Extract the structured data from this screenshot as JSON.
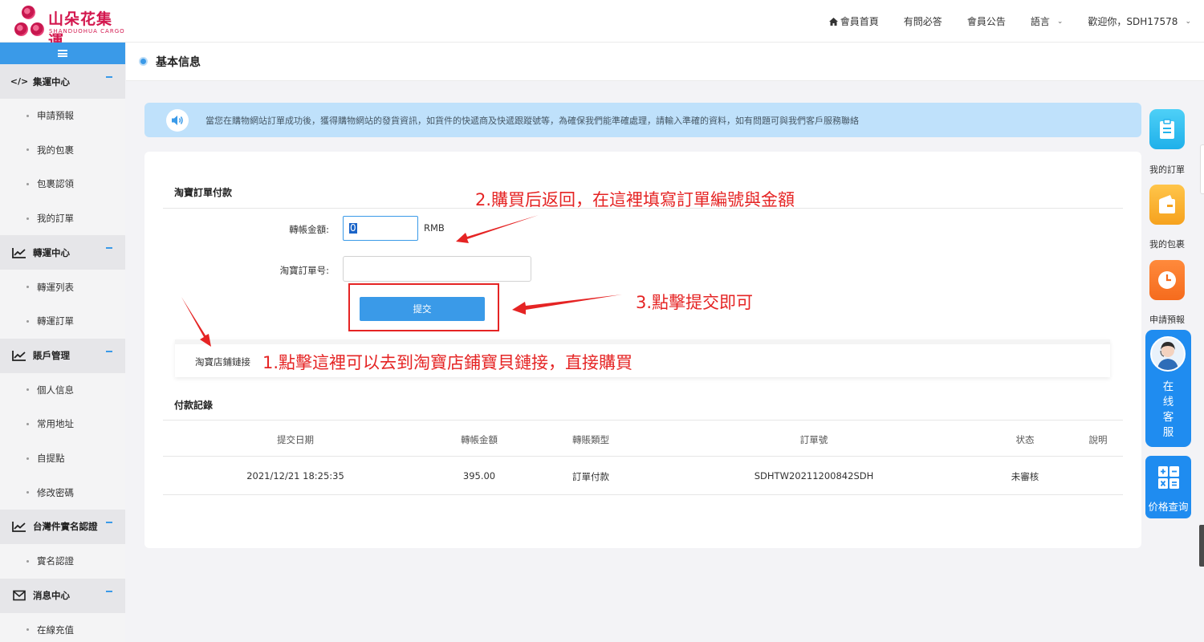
{
  "logo": {
    "name": "山朵花集運",
    "sub": "SHANDUOHUA CARGO"
  },
  "topnav": {
    "home": "會員首頁",
    "faq": "有問必答",
    "announcement": "會員公告",
    "language": "語言",
    "welcome": "歡迎你，SDH17578"
  },
  "sidebar": {
    "sections": [
      {
        "title": "集運中心",
        "items": [
          "申請預報",
          "我的包裹",
          "包裹認領",
          "我的訂單"
        ]
      },
      {
        "title": "轉運中心",
        "items": [
          "轉運列表",
          "轉運訂單"
        ]
      },
      {
        "title": "賬戶管理",
        "items": [
          "個人信息",
          "常用地址",
          "自提點",
          "修改密碼"
        ]
      },
      {
        "title": "台灣件實名認證",
        "items": [
          "實名認證"
        ]
      },
      {
        "title": "消息中心",
        "items": [
          "在線充值"
        ]
      }
    ]
  },
  "page": {
    "title": "基本信息"
  },
  "notice": "當您在購物網站訂單成功後，獲得購物網站的發貨資訊，如貨件的快遞商及快遞跟蹤號等，為確保我們能準確處理，請輸入準確的資料，如有問題可與我們客戶服務聯絡",
  "form": {
    "title": "淘寶訂單付款",
    "amount_label": "轉帳金額:",
    "amount_value": "0",
    "currency": "RMB",
    "order_label": "淘寶訂單号:",
    "order_value": "",
    "submit_label": "提交",
    "shop_link": "淘寶店鋪鏈接"
  },
  "records": {
    "title": "付款記錄",
    "headers": [
      "提交日期",
      "轉帳金額",
      "轉賬類型",
      "訂單號",
      "状态",
      "說明"
    ],
    "rows": [
      [
        "2021/12/21 18:25:35",
        "395.00",
        "訂單付款",
        "SDHTW20211200842SDH",
        "未審核",
        ""
      ]
    ]
  },
  "annotations": {
    "step1": "1.點擊這裡可以去到淘寶店鋪寶貝鏈接，直接購買",
    "step2": "2.購買后返回，在這裡填寫訂單編號與金額",
    "step3": "3.點擊提交即可"
  },
  "float_widgets": {
    "orders": "我的訂單",
    "packages": "我的包裹",
    "forecast": "申請預報",
    "service": "在线客服",
    "price": "价格查询"
  },
  "colors": {
    "accent": "#3a9ae8",
    "annotation": "#e52424",
    "brand": "#d3174e"
  }
}
